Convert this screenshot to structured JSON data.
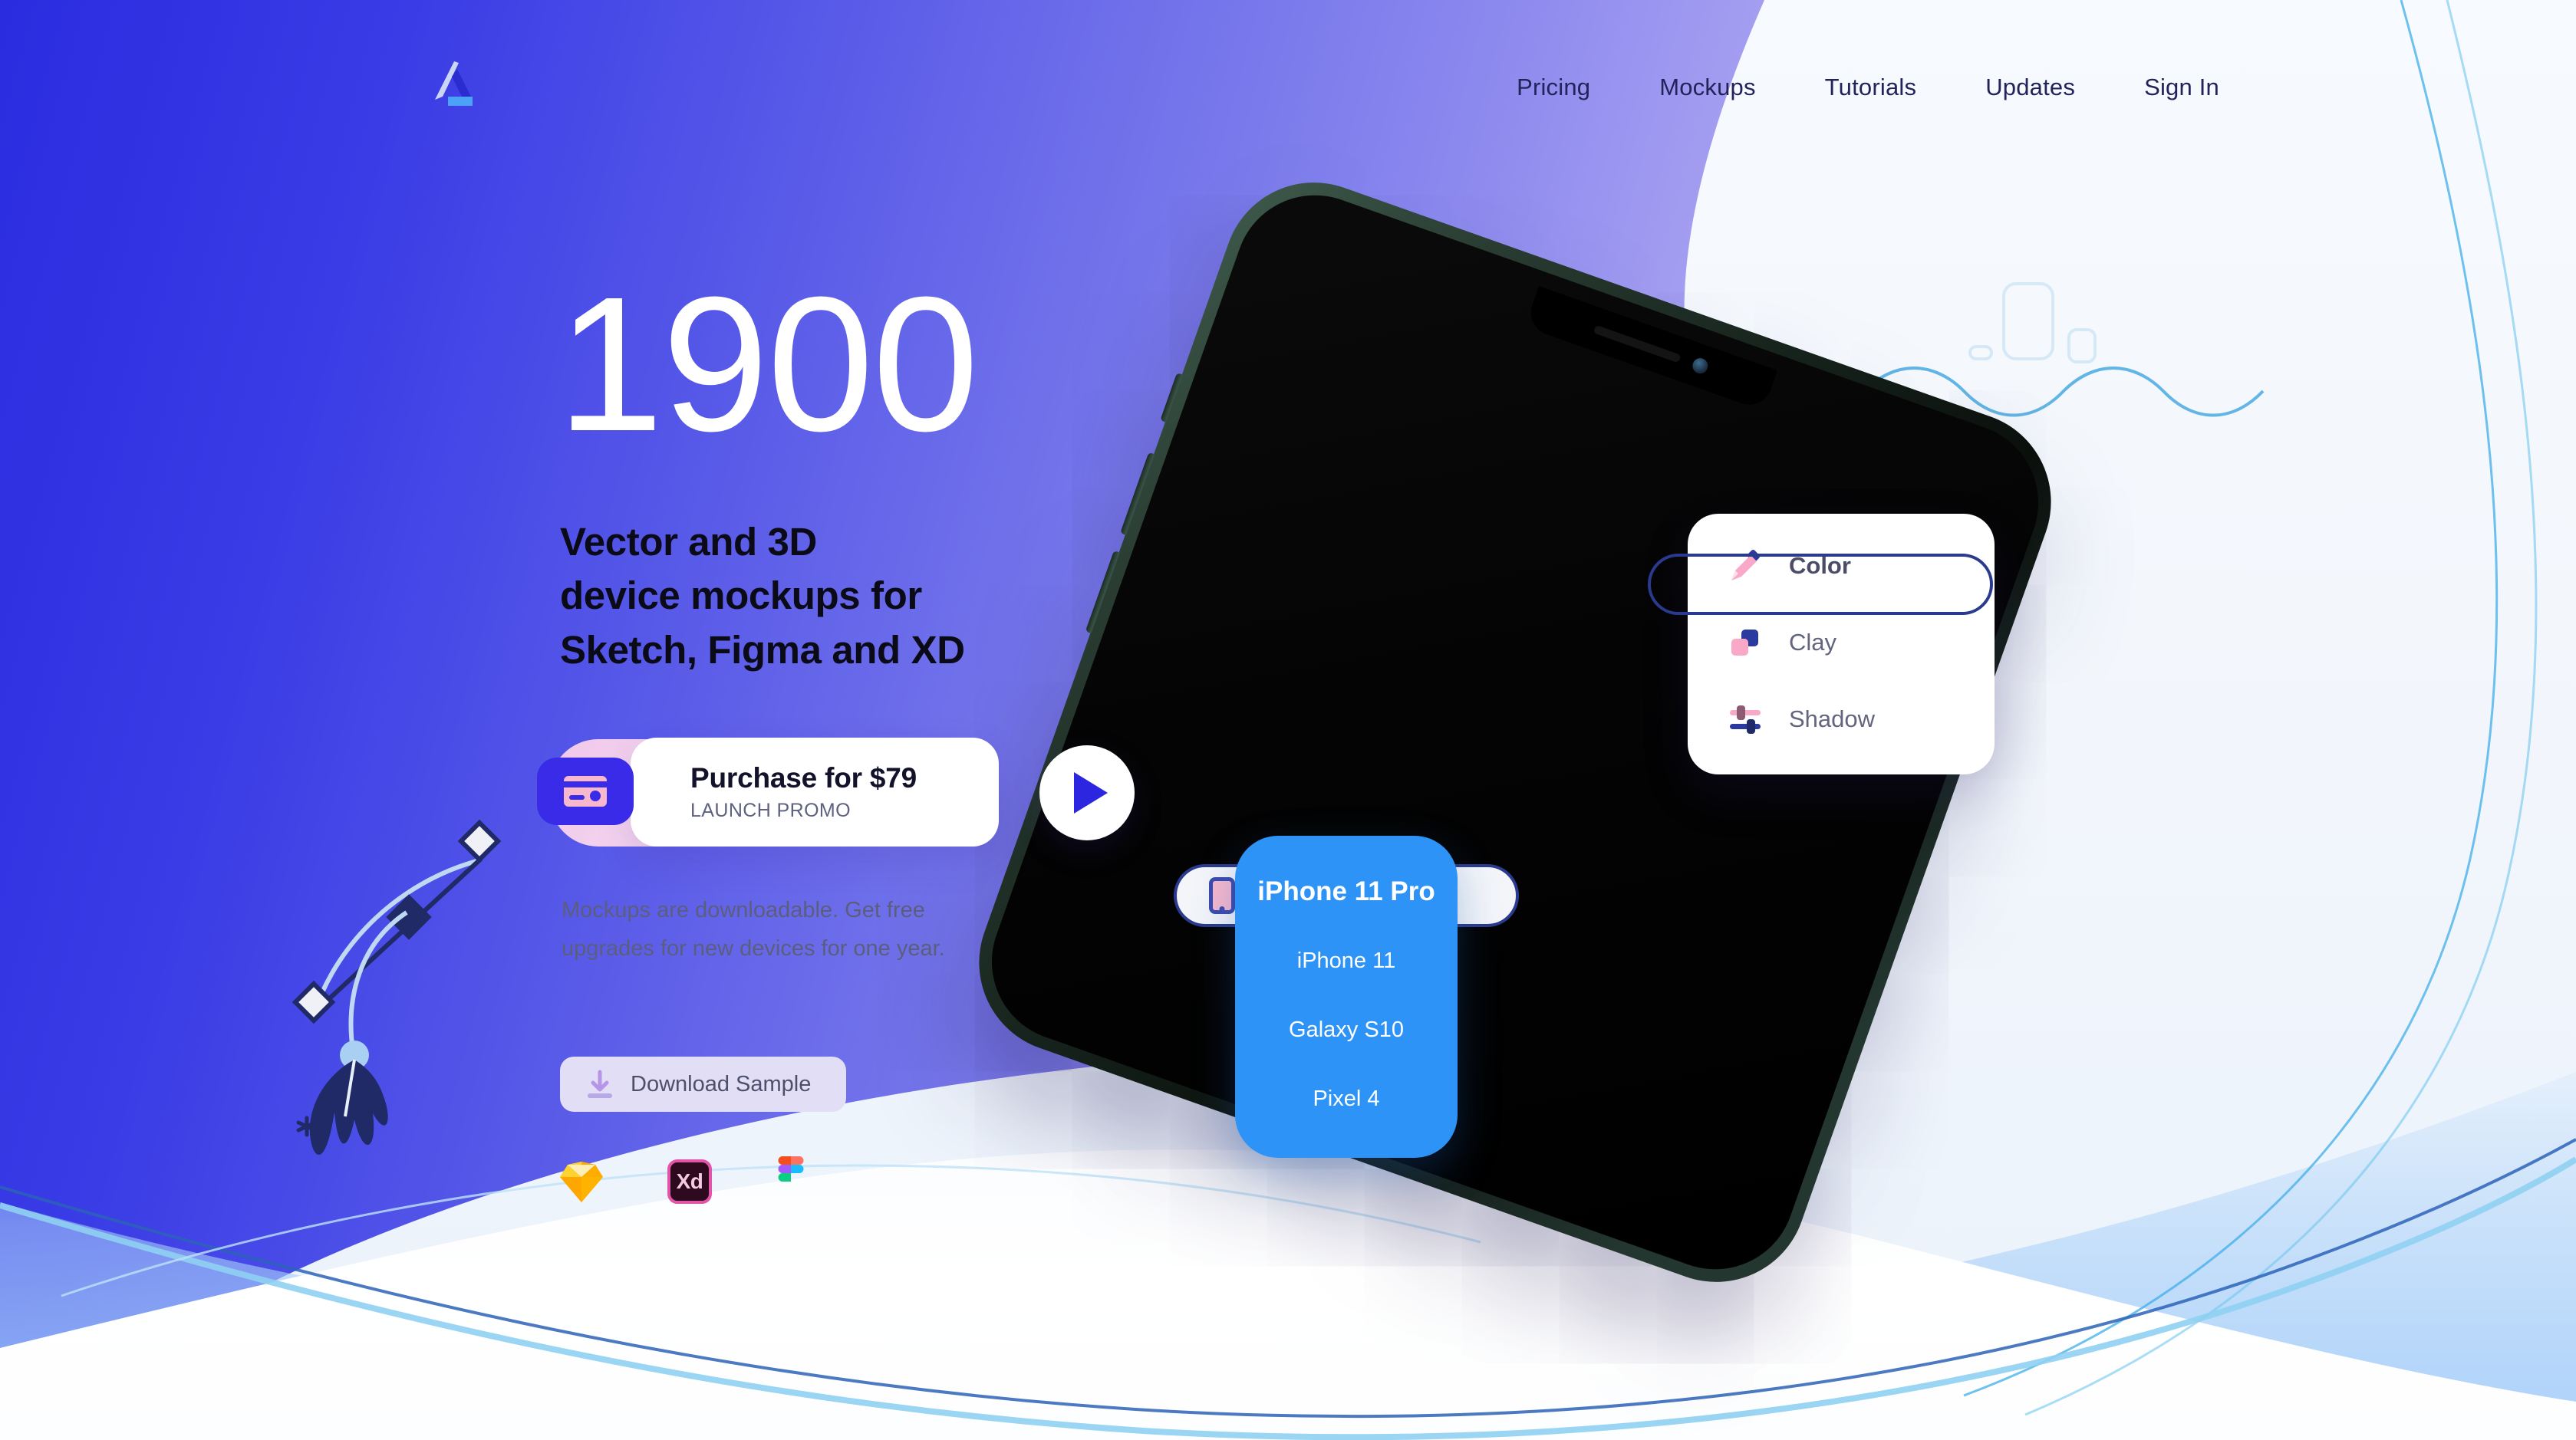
{
  "brand": {
    "logo_name": "aeon-logo"
  },
  "nav": {
    "items": [
      {
        "label": "Pricing"
      },
      {
        "label": "Mockups"
      },
      {
        "label": "Tutorials"
      },
      {
        "label": "Updates"
      },
      {
        "label": "Sign In"
      }
    ]
  },
  "hero": {
    "count": "1900",
    "subheading_line1": "Vector and 3D",
    "subheading_line2": "device mockups for",
    "subheading_line3": "Sketch, Figma and XD",
    "body_line1": "Mockups are downloadable. Get free",
    "body_line2": "upgrades for new devices for one year."
  },
  "cta": {
    "title": "Purchase for $79",
    "sublabel": "LAUNCH PROMO",
    "icon": "credit-card-icon",
    "play_icon": "play-icon"
  },
  "download": {
    "label": "Download Sample",
    "icon": "download-icon"
  },
  "app_logos": [
    {
      "name": "sketch-logo",
      "label": "Sketch"
    },
    {
      "name": "adobe-xd-logo",
      "label": "Xd"
    },
    {
      "name": "figma-logo",
      "label": "Figma"
    }
  ],
  "device_menu": {
    "selected": "iPhone 11 Pro",
    "icon": "phone-icon",
    "options": [
      {
        "label": "iPhone 11 Pro",
        "selected": true
      },
      {
        "label": "iPhone 11",
        "selected": false
      },
      {
        "label": "Galaxy S10",
        "selected": false
      },
      {
        "label": "Pixel 4",
        "selected": false
      }
    ]
  },
  "style_menu": {
    "selected": "Color",
    "options": [
      {
        "label": "Color",
        "icon": "pencil-icon",
        "selected": true
      },
      {
        "label": "Clay",
        "icon": "squares-icon",
        "selected": false
      },
      {
        "label": "Shadow",
        "icon": "sliders-icon",
        "selected": false
      }
    ]
  },
  "decorations": {
    "pen_tool": "pen-tool-icon",
    "wave_line": "wave-line",
    "device_outlines": "device-outline-shapes"
  },
  "colors": {
    "purple_start": "#2A2CE0",
    "purple_end": "#F2F2FC",
    "blue_right": "#2F93F5",
    "accent_indigo": "#3A2BE8",
    "menu_blue": "#2D93F7",
    "navy": "#2A3A8E",
    "pink": "#F7B8CE",
    "text_dark": "#12122B",
    "text_muted": "#5B5E7C"
  }
}
